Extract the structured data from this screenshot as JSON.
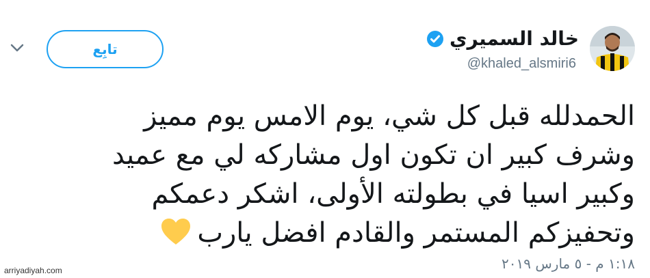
{
  "account": {
    "display_name": "خالد السميري",
    "handle": "@khaled_alsmiri6",
    "verified": true
  },
  "actions": {
    "follow_label": "تابِع",
    "menu_icon": "chevron-down-icon"
  },
  "tweet": {
    "lines": [
      "الحمدلله قبل كل شي، يوم الامس يوم مميز",
      "وشرف كبير ان تكون اول مشاركه لي مع عميد",
      "وكبير اسيا في بطولته الأولى، اشكر دعمكم",
      "وتحفيزكم المستمر والقادم افضل يارب"
    ],
    "emoji": "yellow-heart-icon",
    "timestamp": "١:١٨ م - ٥ مارس ٢٠١٩"
  },
  "watermark": "arriyadiyah.com",
  "colors": {
    "accent": "#1da1f2",
    "text": "#14171a",
    "secondary_text": "#657786",
    "heart": "#ffcc4d"
  }
}
